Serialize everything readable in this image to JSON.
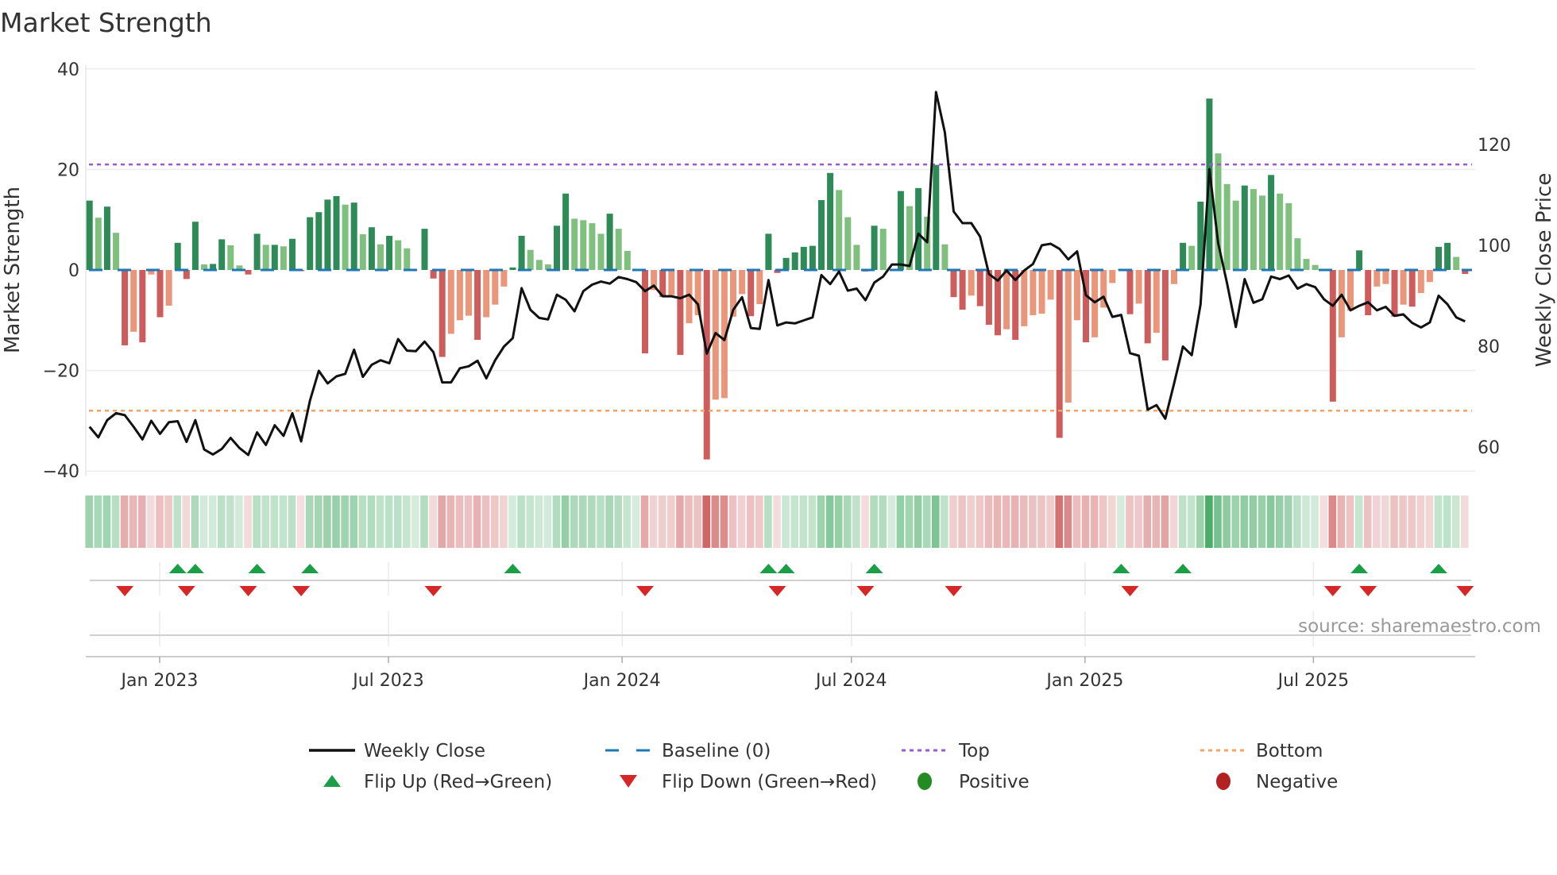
{
  "title": "Market Strength",
  "source": "source: sharemaestro.com",
  "colors": {
    "pos_rising": "#2e8b57",
    "pos_falling": "#7fc07f",
    "neg_falling": "#cd5c5c",
    "neg_rising": "#e9967a",
    "baseline": "#1f77b4",
    "top": "#9b59d6",
    "bottom": "#f4a460",
    "close": "#111111",
    "flip_up": "#1a9e46",
    "flip_down": "#d62728",
    "positive": "#228b22",
    "negative": "#b22222",
    "strip_green": "46,160,80",
    "strip_red": "205,92,92"
  },
  "chart_data": {
    "type": "bar+line",
    "title": "Market Strength",
    "ylabel_left": "Market Strength",
    "ylabel_right": "Weekly Close Price",
    "ylim_left": [
      -40,
      40
    ],
    "ylim_right": [
      55.1,
      134.8
    ],
    "yticks_left": [
      {
        "value": 40,
        "label": "40"
      },
      {
        "value": 20,
        "label": "20"
      },
      {
        "value": 0,
        "label": "0"
      },
      {
        "value": -20,
        "label": "−20"
      },
      {
        "value": -40,
        "label": "−40"
      }
    ],
    "yticks_right": [
      {
        "value": 120,
        "label": "120"
      },
      {
        "value": 100,
        "label": "100"
      },
      {
        "value": 80,
        "label": "80"
      },
      {
        "value": 60,
        "label": "60"
      }
    ],
    "xticks": [
      {
        "week": 7.95,
        "label": "Jan 2023"
      },
      {
        "week": 33.9,
        "label": "Jul 2023"
      },
      {
        "week": 60.4,
        "label": "Jan 2024"
      },
      {
        "week": 86.4,
        "label": "Jul 2024"
      },
      {
        "week": 112.9,
        "label": "Jan 2025"
      },
      {
        "week": 138.8,
        "label": "Jul 2025"
      }
    ],
    "top_level": 21,
    "bottom_level": -28,
    "baseline": 0,
    "strength": [
      13.8,
      10.4,
      12.6,
      7.4,
      -15,
      -12.3,
      -14.4,
      -0.9,
      -9.4,
      -7.1,
      5.4,
      -1.8,
      9.6,
      1.1,
      1.2,
      6.1,
      4.9,
      0.9,
      -0.9,
      7.2,
      5,
      5,
      4.7,
      6.2,
      -0.2,
      10.5,
      11.5,
      14,
      14.7,
      13,
      13.4,
      7.1,
      8.5,
      5.1,
      6.8,
      5.9,
      4.3,
      0,
      8.2,
      -1.7,
      -17.3,
      -12.7,
      -10,
      -9.1,
      -13.9,
      -9.4,
      -6.9,
      -3.3,
      0.5,
      6.8,
      4.0,
      2.0,
      1.1,
      8.8,
      15.2,
      10.2,
      9.9,
      9.3,
      7.2,
      11.2,
      8.2,
      3.8,
      0,
      -16.6,
      -4,
      -5.4,
      -5,
      -16.9,
      -10.6,
      -9,
      -37.7,
      -25.8,
      -25.5,
      -9.3,
      -4.8,
      -9.2,
      -6.8,
      7.2,
      -0.6,
      2.4,
      3.5,
      4.6,
      4.8,
      13.9,
      19.3,
      15.9,
      10.5,
      5.0,
      -0.3,
      8.8,
      8.2,
      0,
      15.7,
      12.7,
      16.3,
      10.6,
      20.9,
      5.1,
      -5.4,
      -7.9,
      -5.1,
      -7.2,
      -10.9,
      -13.0,
      -11.8,
      -13.9,
      -11.2,
      -9.0,
      -8.7,
      -5.9,
      -33.4,
      -26.4,
      -10.0,
      -14.4,
      -13.4,
      -7.5,
      -2.6,
      0.2,
      -8.8,
      -6.7,
      -14.6,
      -12.5,
      -18.0,
      -2.8,
      5.4,
      4.8,
      13.6,
      34.1,
      23.2,
      17.1,
      13.8,
      16.8,
      16.1,
      14.8,
      18.9,
      15.2,
      13.3,
      6.3,
      2.2,
      1.0,
      -0.2,
      -26.2,
      -13.4,
      -8.1,
      3.9,
      -9.0,
      -3.3,
      -2.8,
      -9.3,
      -6.9,
      -7.3,
      -4.6,
      -2.4,
      4.6,
      5.4,
      2.6,
      -0.8
    ],
    "weekly_close": [
      64.0,
      61.9,
      65.3,
      66.7,
      66.3,
      64.0,
      61.5,
      65.2,
      62.6,
      64.9,
      65.1,
      61.0,
      65.3,
      59.5,
      58.5,
      59.6,
      61.8,
      59.8,
      58.4,
      62.9,
      60.4,
      64.3,
      62.2,
      66.7,
      61.1,
      69.2,
      75.1,
      72.6,
      74.0,
      74.5,
      79.3,
      73.9,
      76.3,
      77.2,
      76.6,
      81.4,
      79.1,
      79.0,
      80.9,
      78.8,
      72.8,
      72.8,
      75.6,
      76.0,
      77.1,
      73.6,
      77.2,
      79.9,
      81.6,
      91.5,
      87.2,
      85.6,
      85.3,
      90.2,
      89.2,
      86.9,
      90.9,
      92.2,
      92.8,
      92.4,
      93.7,
      93.3,
      92.7,
      90.9,
      92.0,
      89.9,
      89.9,
      89.5,
      90.2,
      88.3,
      78.5,
      82.6,
      81.2,
      87.2,
      89.7,
      83.6,
      83.4,
      93.1,
      84.1,
      84.7,
      84.5,
      85.1,
      85.7,
      94.1,
      92.3,
      94.8,
      91.0,
      91.4,
      89.1,
      92.6,
      93.8,
      96.2,
      96.2,
      95.9,
      102.3,
      100.6,
      130.4,
      122.4,
      106.7,
      104.4,
      104.4,
      101.7,
      94.3,
      93.0,
      95.0,
      93.1,
      95.0,
      96.3,
      100.0,
      100.3,
      99.3,
      97.2,
      98.8,
      90.1,
      88.7,
      89.8,
      85.8,
      86.2,
      78.6,
      78.1,
      67.4,
      68.3,
      65.6,
      72.6,
      79.9,
      78.2,
      88.3,
      115.1,
      100.4,
      92.5,
      83.8,
      93.3,
      88.6,
      89.3,
      93.8,
      93.3,
      94.0,
      91.4,
      92.3,
      91.7,
      89.3,
      88.0,
      90.2,
      87.1,
      88.0,
      88.7,
      87.1,
      87.8,
      86.0,
      86.3,
      84.6,
      83.7,
      84.7,
      90.0,
      88.3,
      85.7,
      84.9
    ],
    "flip_up_weeks": [
      10,
      12,
      19,
      25,
      48,
      77,
      79,
      89,
      117,
      124,
      144,
      153
    ],
    "flip_down_weeks": [
      4,
      11,
      18,
      24,
      39,
      63,
      78,
      88,
      98,
      118,
      141,
      145,
      156
    ],
    "legend": {
      "placement": "bottom",
      "items": [
        {
          "key": "close",
          "label": "Weekly Close"
        },
        {
          "key": "baseline",
          "label": "Baseline (0)"
        },
        {
          "key": "top",
          "label": "Top"
        },
        {
          "key": "bottom",
          "label": "Bottom"
        },
        {
          "key": "flip_up",
          "label": "Flip Up (Red→Green)"
        },
        {
          "key": "flip_down",
          "label": "Flip Down (Green→Red)"
        },
        {
          "key": "positive",
          "label": "Positive"
        },
        {
          "key": "negative",
          "label": "Negative"
        }
      ]
    }
  }
}
